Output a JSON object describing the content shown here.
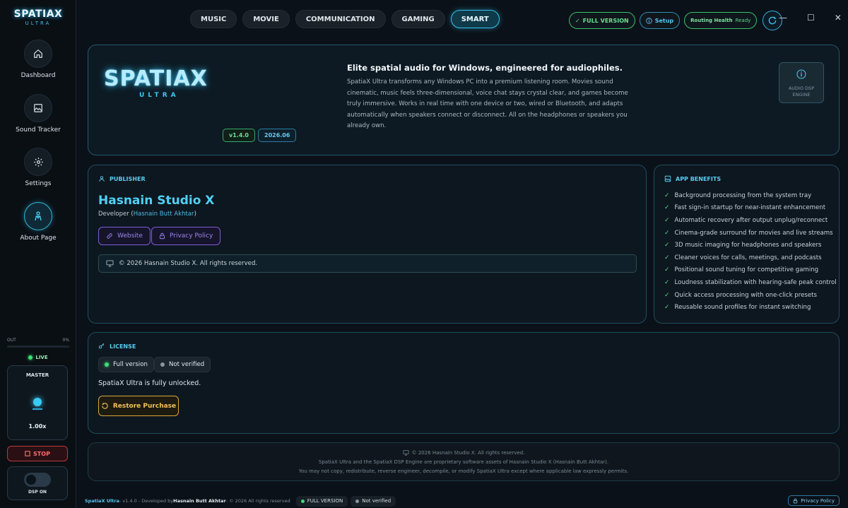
{
  "app": {
    "brand_title": "SPATIAX",
    "brand_subtitle": "ULTRA"
  },
  "sidebar": {
    "items": [
      {
        "label": "Dashboard",
        "icon": "home-icon",
        "active": false
      },
      {
        "label": "Sound Tracker",
        "icon": "image-icon",
        "active": false
      },
      {
        "label": "Settings",
        "icon": "gear-icon",
        "active": false
      },
      {
        "label": "About Page",
        "icon": "user-icon",
        "active": true
      }
    ],
    "meter": {
      "left_label": "OUT",
      "right_label": "0%",
      "level": 0
    },
    "live_label": "LIVE",
    "master": {
      "label": "MASTER",
      "value": "1.00x"
    },
    "stop_label": "STOP",
    "dsp_label": "DSP ON"
  },
  "tabs": [
    {
      "label": "MUSIC",
      "active": false
    },
    {
      "label": "MOVIE",
      "active": false
    },
    {
      "label": "COMMUNICATION",
      "active": false
    },
    {
      "label": "GAMING",
      "active": false
    },
    {
      "label": "SMART",
      "active": true
    }
  ],
  "topbar": {
    "full_version": "FULL VERSION",
    "setup": "Setup",
    "routing_health": "Routing Health",
    "routing_status": "Ready"
  },
  "window_controls": {
    "minimize": "—",
    "maximize": "☐",
    "close": "✕"
  },
  "hero": {
    "logo_title": "SPATIAX",
    "logo_subtitle": "ULTRA",
    "version": "v1.4.0",
    "build": "2026.06",
    "headline": "Elite spatial audio for Windows, engineered for audiophiles.",
    "description": "SpatiaX Ultra transforms any Windows PC into a premium listening room. Movies sound cinematic, music feels three-dimensional, voice chat stays crystal clear, and games become truly immersive. Works in real time with one device or two, wired or Bluetooth, and adapts automatically when speakers connect or disconnect. All on the headphones or speakers you already own.",
    "dsp_engine_line1": "AUDIO DSP",
    "dsp_engine_line2": "ENGINE"
  },
  "publisher": {
    "section_title": "PUBLISHER",
    "name": "Hasnain Studio X",
    "developer_prefix": "Developer (",
    "developer_name": "Hasnain Butt Akhtar",
    "developer_suffix": ")",
    "website_label": "Website",
    "privacy_label": "Privacy Policy",
    "copyright": "© 2026 Hasnain Studio X. All rights reserved."
  },
  "benefits": {
    "section_title": "APP BENEFITS",
    "items": [
      "Background processing from the system tray",
      "Fast sign-in startup for near-instant enhancement",
      "Automatic recovery after output unplug/reconnect",
      "Cinema-grade surround for movies and live streams",
      "3D music imaging for headphones and speakers",
      "Cleaner voices for calls, meetings, and podcasts",
      "Positional sound tuning for competitive gaming",
      "Loudness stabilization with hearing-safe peak control",
      "Quick access processing with one-click presets",
      "Reusable sound profiles for instant switching"
    ]
  },
  "license": {
    "section_title": "LICENSE",
    "status_full": "Full version",
    "status_verified": "Not verified",
    "message": "SpatiaX Ultra is fully unlocked.",
    "restore_label": "Restore Purchase"
  },
  "footer": {
    "line1": "© 2026 Hasnain Studio X. All rights reserved.",
    "line2": "SpatiaX Ultra and the SpatiaX DSP Engine are proprietary software assets of Hasnain Studio X (Hasnain Butt Akhtar).",
    "line3": "You may not copy, redistribute, reverse engineer, decompile, or modify SpatiaX Ultra except where applicable law expressly permits."
  },
  "statusbar": {
    "brand": "SpatiaX Ultra",
    "version_text": " - v1.4.0 - Developed by ",
    "developer": "Hasnain Butt Akhtar",
    "rights": " - © 2026 All rights reserved",
    "full_version": "FULL VERSION",
    "verified": "Not verified",
    "privacy": "Privacy Policy"
  },
  "colors": {
    "accent": "#31c2ea",
    "success": "#3fdc76",
    "warning": "#d7a83b",
    "danger": "#ff6b6b",
    "purple": "#7a5cd6"
  }
}
